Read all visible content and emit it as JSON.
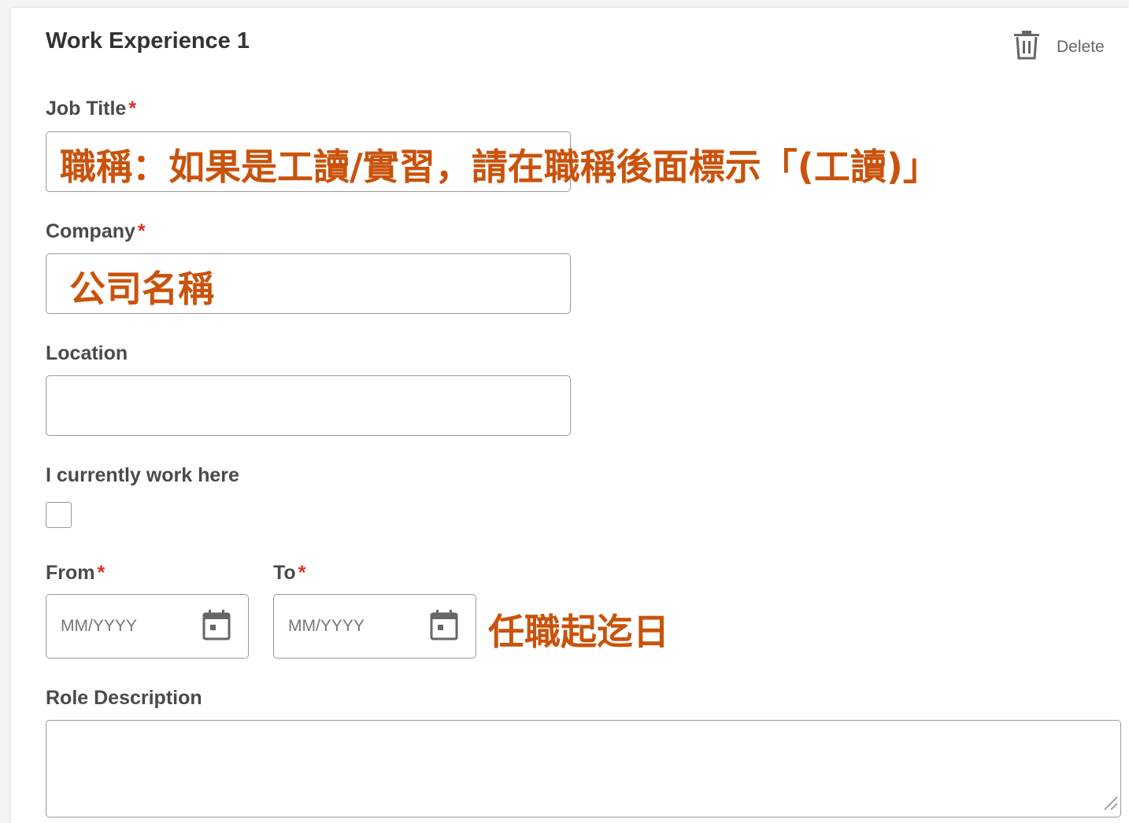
{
  "section": {
    "title": "Work Experience 1",
    "delete_label": "Delete"
  },
  "fields": {
    "job_title": {
      "label": "Job Title",
      "required_mark": "*",
      "value": ""
    },
    "company": {
      "label": "Company",
      "required_mark": "*",
      "value": ""
    },
    "location": {
      "label": "Location",
      "value": ""
    },
    "current": {
      "label": "I currently work here",
      "checked": false
    },
    "from": {
      "label": "From",
      "required_mark": "*",
      "placeholder": "MM/YYYY"
    },
    "to": {
      "label": "To",
      "required_mark": "*",
      "placeholder": "MM/YYYY"
    },
    "role_description": {
      "label": "Role Description",
      "value": ""
    }
  },
  "annotations": {
    "job_title_note": "職稱：如果是工讀/實習，請在職稱後面標示「(工讀)」",
    "company_note": "公司名稱",
    "date_note": "任職起迄日"
  },
  "colors": {
    "annotation": "#c9530c",
    "required": "#de2e21",
    "border": "#999999"
  },
  "icons": {
    "delete": "trash-icon",
    "date": "calendar-icon",
    "resize": "resize-handle-icon"
  }
}
